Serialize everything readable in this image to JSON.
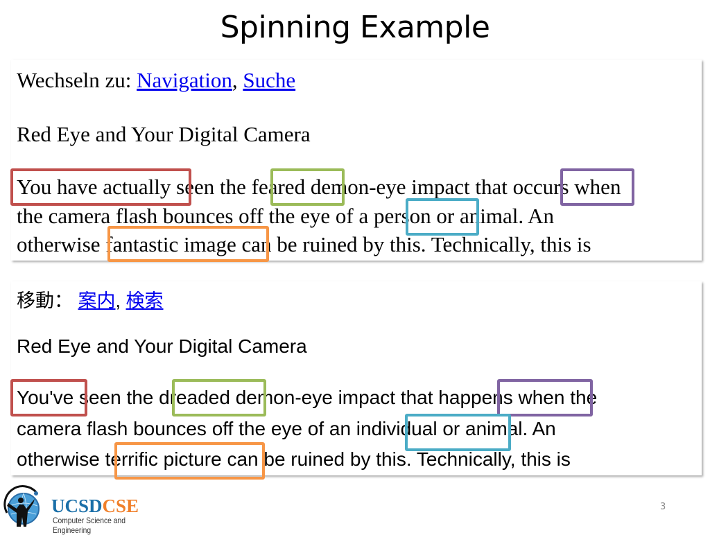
{
  "slide": {
    "title": "Spinning Example",
    "page_number": "3"
  },
  "colors": {
    "red": "#c0504d",
    "green": "#9bbb59",
    "purple": "#8064a2",
    "blue": "#4bacc6",
    "orange": "#f79646",
    "link": "#0000ee"
  },
  "original": {
    "nav_prefix": "Wechseln zu: ",
    "nav_links": [
      "Navigation",
      "Suche"
    ],
    "nav_sep": ", ",
    "heading": "Red Eye and Your Digital Camera",
    "line1": {
      "p1": "You have actually",
      "p2": " seen the ",
      "p3": "feared",
      "p4": " demon-eye impact that ",
      "p5": "occurs",
      "p6": " when"
    },
    "line2": {
      "p1": "the camera flash bounces off the eye of a ",
      "p2": "person",
      "p3": " or animal. An"
    },
    "line3": {
      "p1": "otherwise ",
      "p2": "fantastic image ",
      "p3": "can be ruined by this. Technically, this is"
    }
  },
  "spun": {
    "nav_prefix": "移動： ",
    "nav_links": [
      "案内",
      "検索"
    ],
    "nav_sep": ", ",
    "heading": "Red Eye and Your Digital Camera",
    "line1": {
      "p1": "You've",
      "p2": " seen the ",
      "p3": "dreaded",
      "p4": " demon-eye impact that ",
      "p5": "happens",
      "p6": " when the"
    },
    "line2": {
      "p1": "camera flash bounces off the eye of an ",
      "p2": "individual",
      "p3": " or animal. An"
    },
    "line3": {
      "p1": "otherwise ",
      "p2": "terrific picture",
      "p3": " can be ruined by this. Technically, this is"
    }
  },
  "footer": {
    "logo_ucsd": "UCSD",
    "logo_cse": "CSE",
    "dept": "Computer Science and Engineering"
  }
}
